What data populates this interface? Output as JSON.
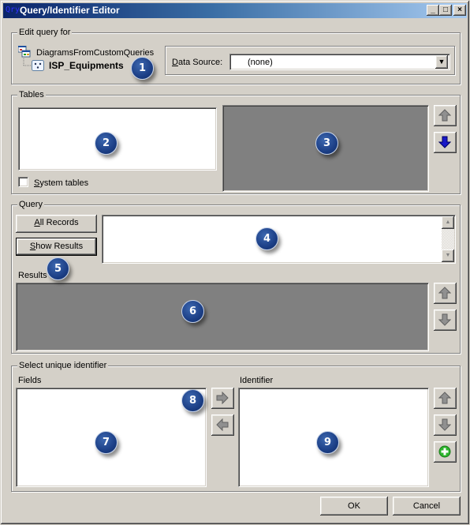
{
  "window": {
    "title": "Query/Identifier Editor",
    "icon_text": "Qry",
    "controls": {
      "minimize": "_",
      "maximize": "□",
      "close": "×"
    }
  },
  "edit_query": {
    "group_label": "Edit query for",
    "tree": {
      "parent": "DiagramsFromCustomQueries",
      "child": "ISP_Equipments"
    },
    "data_source": {
      "label_prefix": "D",
      "label_rest": "ata Source:",
      "value": "(none)"
    }
  },
  "tables": {
    "group_label": "Tables",
    "system_tables": {
      "prefix": "S",
      "rest": "ystem tables",
      "checked": false
    }
  },
  "query": {
    "group_label": "Query",
    "all_records": {
      "prefix": "A",
      "rest": "ll Records"
    },
    "show_results": {
      "prefix": "S",
      "rest": "how Results"
    },
    "query_text": "",
    "results_label": "Results"
  },
  "identifier": {
    "group_label": "Select unique identifier",
    "fields_label": "Fields",
    "identifier_label": "Identifier"
  },
  "footer": {
    "ok": "OK",
    "cancel": "Cancel"
  },
  "callouts": [
    "1",
    "2",
    "3",
    "4",
    "5",
    "6",
    "7",
    "8",
    "9"
  ],
  "colors": {
    "title_gradient_start": "#0a246a",
    "title_gradient_end": "#a6caf0",
    "face": "#d4d0c8",
    "disabled_panel": "#808080",
    "callout": "#1c3f86",
    "arrow_active": "#1010c0",
    "add_green": "#22aa22"
  }
}
